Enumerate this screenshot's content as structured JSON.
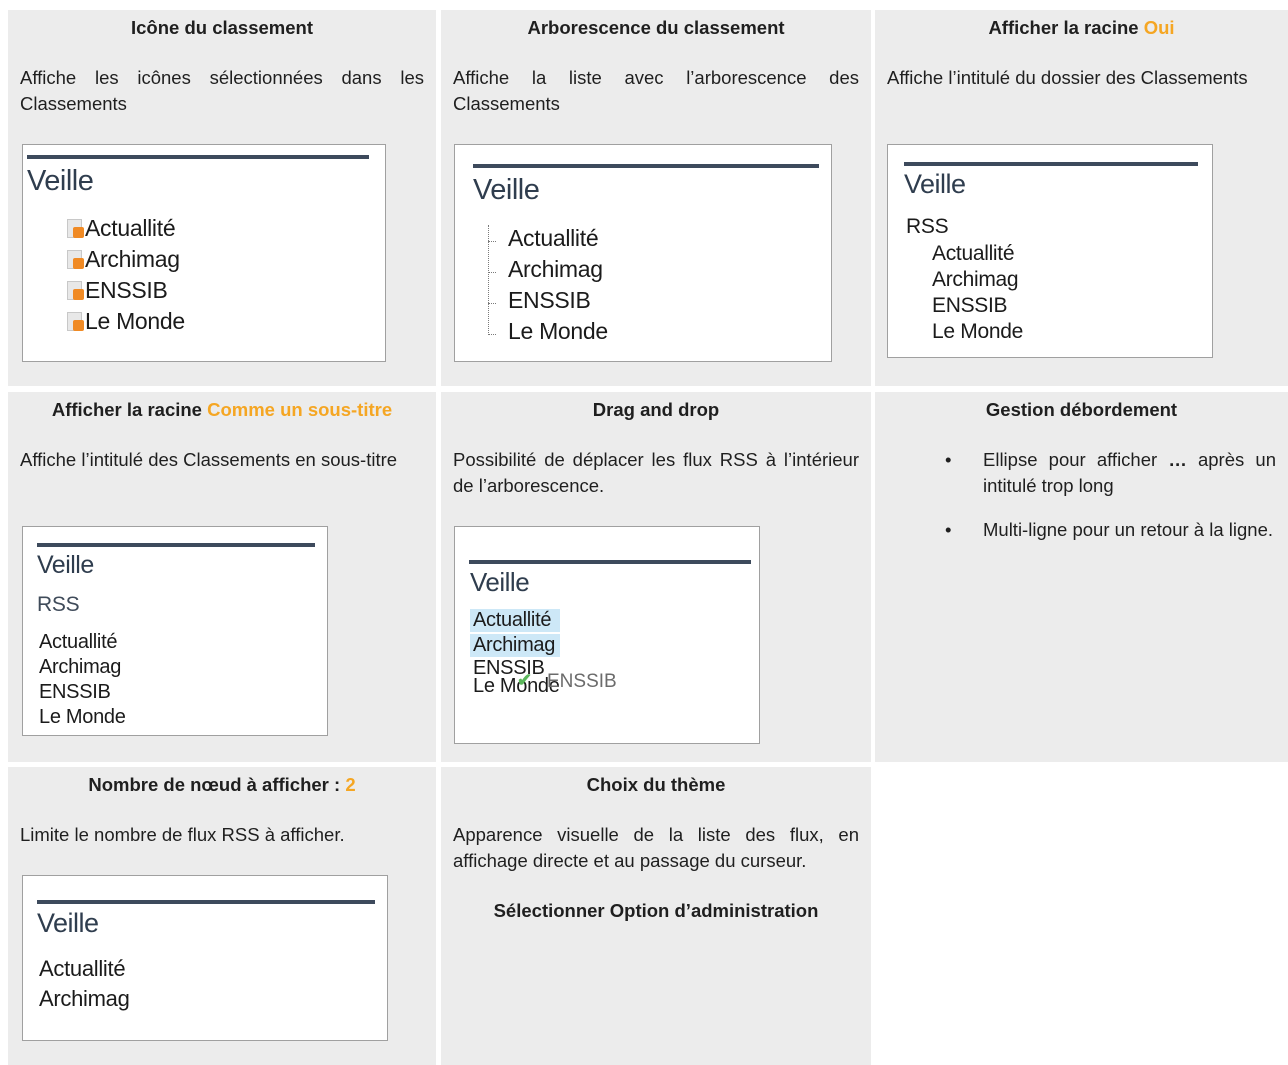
{
  "cells": {
    "icone": {
      "title": "Icône du classement",
      "desc": "Affiche les icônes sélectionnées dans les Classements",
      "preview": {
        "title": "Veille",
        "items": [
          "Actuallité",
          "Archimag",
          "ENSSIB",
          "Le Monde"
        ],
        "icon": "rss-feed-icon"
      }
    },
    "arborescence": {
      "title": "Arborescence du classement",
      "desc": "Affiche la liste avec l’arborescence des Classements",
      "preview": {
        "title": "Veille",
        "items": [
          "Actuallité",
          "Archimag",
          "ENSSIB",
          "Le Monde"
        ]
      }
    },
    "racine_oui": {
      "title_prefix": "Afficher la racine ",
      "title_value": "Oui",
      "desc": "Affiche l’intitulé du dossier des Classements",
      "preview": {
        "title": "Veille",
        "root": "RSS",
        "items": [
          "Actuallité",
          "Archimag",
          "ENSSIB",
          "Le Monde"
        ]
      }
    },
    "racine_sous_titre": {
      "title_prefix": "Afficher la racine ",
      "title_value": "Comme un sous-titre",
      "desc": "Affiche l’intitulé des Classements en sous-titre",
      "preview": {
        "title": "Veille",
        "subtitle": "RSS",
        "items": [
          "Actuallité",
          "Archimag",
          "ENSSIB",
          "Le Monde"
        ]
      }
    },
    "drag_drop": {
      "title": "Drag and drop",
      "desc": "Possibilité de déplacer les flux RSS à l’intérieur de l’arborescence.",
      "preview": {
        "title": "Veille",
        "items": [
          "Actuallité",
          "Archimag",
          "ENSSIB",
          "Le Monde"
        ],
        "dragging": "ENSSIB"
      }
    },
    "debordement": {
      "title": "Gestion débordement",
      "bullets": [
        {
          "before": "Ellipse pour afficher ",
          "bold": "…",
          "after": " après un intitulé trop long"
        },
        {
          "before": "Multi-ligne pour un retour à la ligne.",
          "bold": "",
          "after": ""
        }
      ]
    },
    "noeuds": {
      "title_prefix": "Nombre de nœud à afficher : ",
      "title_value": "2",
      "desc": "Limite le nombre de flux RSS à afficher.",
      "preview": {
        "title": "Veille",
        "items": [
          "Actuallité",
          "Archimag"
        ]
      }
    },
    "theme": {
      "title": "Choix du thème",
      "desc": "Apparence visuelle de la liste des flux, en affichage directe et au passage du curseur.",
      "note": "Sélectionner Option d’administration"
    }
  },
  "colors": {
    "highlight": "#f5a623",
    "cell_bg": "#ececec",
    "rule": "#3d4a5c",
    "selection": "#cde8f7",
    "drop_check": "#5cb85c"
  }
}
